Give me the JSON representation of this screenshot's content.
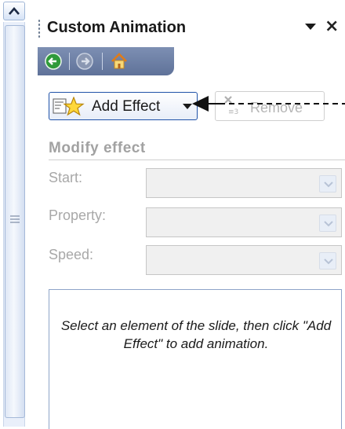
{
  "pane": {
    "title": "Custom Animation"
  },
  "toolbar": {
    "add_effect_label": "Add Effect",
    "remove_label": "Remove"
  },
  "modify": {
    "section_title": "Modify effect",
    "fields": [
      {
        "label": "Start:",
        "value": ""
      },
      {
        "label": "Property:",
        "value": ""
      },
      {
        "label": "Speed:",
        "value": ""
      }
    ]
  },
  "list": {
    "message": "Select an element of the slide, then click \"Add Effect\" to add animation."
  },
  "icons": {
    "back": "back-arrow-icon",
    "forward": "forward-arrow-icon",
    "home": "home-icon",
    "add_effect": "star-effect-icon",
    "remove": "remove-x-icon"
  },
  "colors": {
    "nav_bar": "#6b7ea6",
    "add_effect_border": "#1f52a8",
    "disabled_text": "#a8a8a8",
    "list_border": "#8ea4c8"
  }
}
